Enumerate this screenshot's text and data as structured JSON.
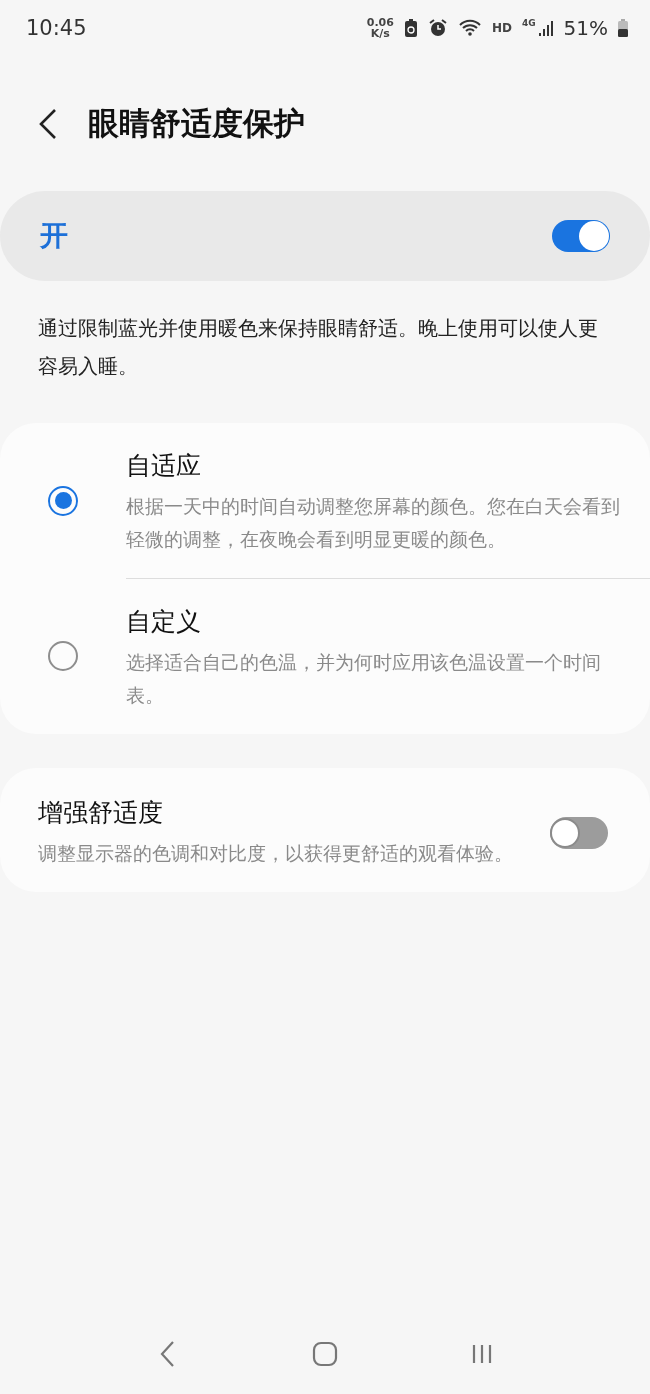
{
  "status_bar": {
    "time": "10:45",
    "net_speed": "0.06",
    "net_unit": "K/s",
    "hd": "HD",
    "network": "4G",
    "battery": "51%"
  },
  "header": {
    "title": "眼睛舒适度保护"
  },
  "master": {
    "label": "开",
    "on": true
  },
  "description": "通过限制蓝光并使用暖色来保持眼睛舒适。晚上使用可以使人更容易入睡。",
  "modes": [
    {
      "title": "自适应",
      "summary": "根据一天中的时间自动调整您屏幕的颜色。您在白天会看到轻微的调整，在夜晚会看到明显更暖的颜色。",
      "selected": true
    },
    {
      "title": "自定义",
      "summary": "选择适合自己的色温，并为何时应用该色温设置一个时间表。",
      "selected": false
    }
  ],
  "enhance": {
    "title": "增强舒适度",
    "summary": "调整显示器的色调和对比度，以获得更舒适的观看体验。",
    "on": false
  }
}
